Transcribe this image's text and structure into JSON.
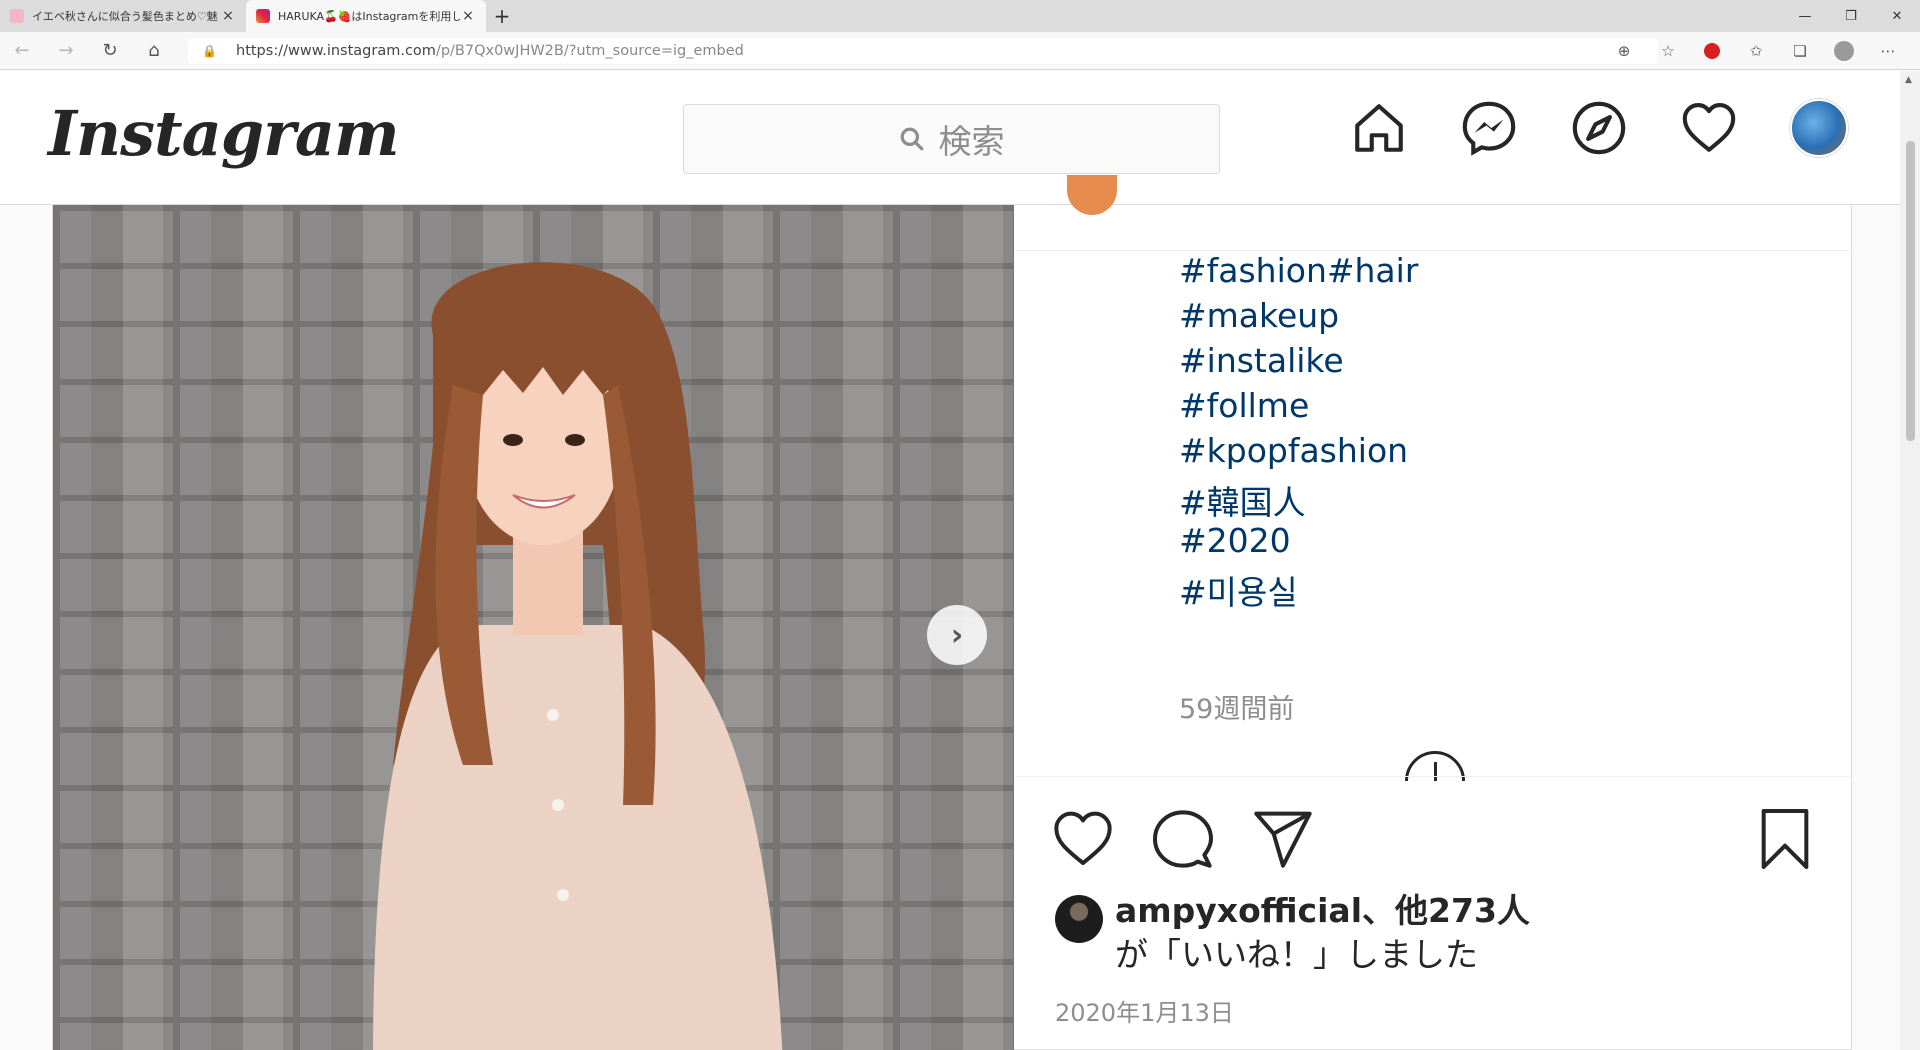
{
  "browser": {
    "tabs": [
      {
        "title": "イエベ秋さんに似合う髪色まとめ♡魅",
        "active": false,
        "favicon_color": "#f4b6c2"
      },
      {
        "title": "HARUKA🍒🍓はInstagramを利用し",
        "active": true,
        "favicon_color": "#c13584"
      }
    ],
    "new_tab": "+",
    "close_glyph": "×",
    "window_controls": {
      "minimize": "—",
      "maximize": "❐",
      "close": "✕"
    },
    "url_host": "https://www.instagram.com",
    "url_path": "/p/B7Qx0wJHW2B/?utm_source=ig_embed",
    "nav": {
      "back": "←",
      "forward": "→",
      "reload": "↻",
      "home": "⌂"
    },
    "toolbar_icons": [
      "zoom-icon",
      "add-favorite-icon",
      "extension-icon",
      "favorites-icon",
      "collections-icon",
      "profile-icon",
      "more-icon"
    ],
    "more_glyph": "⋯"
  },
  "instagram": {
    "logo": "Instagram",
    "search_placeholder": "検索",
    "nav_icons": [
      "home-icon",
      "messenger-icon",
      "explore-icon",
      "activity-heart-icon",
      "profile-avatar"
    ]
  },
  "post": {
    "hashtags": [
      "#fashion#hair",
      "#makeup",
      "#instalike",
      "#follme",
      "#kpopfashion",
      "#韓国人",
      "#2020",
      "#미용실"
    ],
    "time_ago": "59週間前",
    "liked_by_name": "ampyxofficial",
    "liked_by_count": "、他273人",
    "liked_suffix": "が「いいね！」しました",
    "date": "2020年1月13日",
    "next_arrow": "›"
  },
  "colors": {
    "hashtag": "#00376b",
    "muted": "#8e8e8e",
    "text": "#262626"
  }
}
